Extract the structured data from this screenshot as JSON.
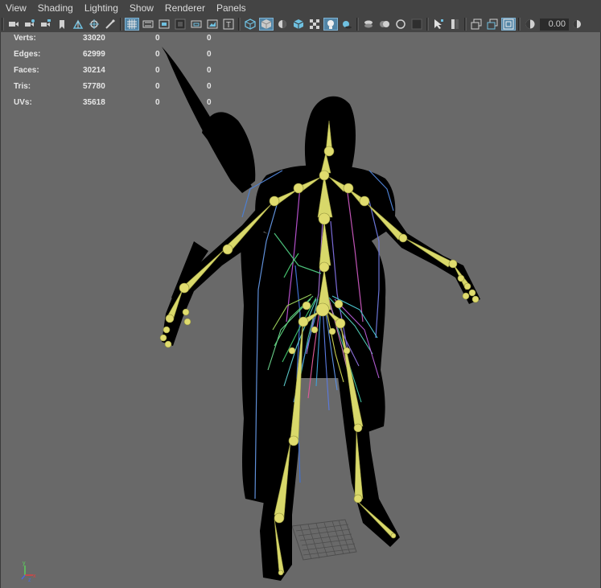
{
  "menu": [
    "View",
    "Shading",
    "Lighting",
    "Show",
    "Renderer",
    "Panels"
  ],
  "toolbar": {
    "icons": [
      "select-camera-icon",
      "camera-attributes-icon",
      "bookmarks-icon",
      "image-plane-icon",
      "2d-pan-zoom-icon",
      "grease-pencil-icon",
      "grid-icon",
      "film-gate-icon",
      "resolution-gate-icon",
      "gate-mask-icon",
      "field-chart-icon",
      "safe-action-icon",
      "safe-title-icon",
      "wireframe-icon",
      "smooth-shade-icon",
      "default-material-icon",
      "wireframe-on-shaded-icon",
      "xray-icon",
      "xray-joints-icon",
      "use-all-lights-icon",
      "shadows-icon",
      "screen-space-ao-icon",
      "motion-blur-icon",
      "multisample-aa-icon",
      "depth-of-field-icon",
      "isolate-select-icon",
      "xray-active-icon",
      "two-pane-icon",
      "four-pane-icon",
      "hud-icon",
      "exposure-icon",
      "gamma-icon"
    ],
    "exposure_value": "0.00"
  },
  "hud": [
    {
      "label": "Verts:",
      "v1": "33020",
      "v2": "0",
      "v3": "0"
    },
    {
      "label": "Edges:",
      "v1": "62999",
      "v2": "0",
      "v3": "0"
    },
    {
      "label": "Faces:",
      "v1": "30214",
      "v2": "0",
      "v3": "0"
    },
    {
      "label": "Tris:",
      "v1": "57780",
      "v2": "0",
      "v3": "0"
    },
    {
      "label": "UVs:",
      "v1": "35618",
      "v2": "0",
      "v3": "0"
    }
  ],
  "axis": {
    "x": "x",
    "y": "y",
    "z": "z"
  },
  "colors": {
    "viewport": "#696969",
    "joint": "#d8d86a",
    "silhouette": "#000000",
    "active": "#5285a6"
  }
}
